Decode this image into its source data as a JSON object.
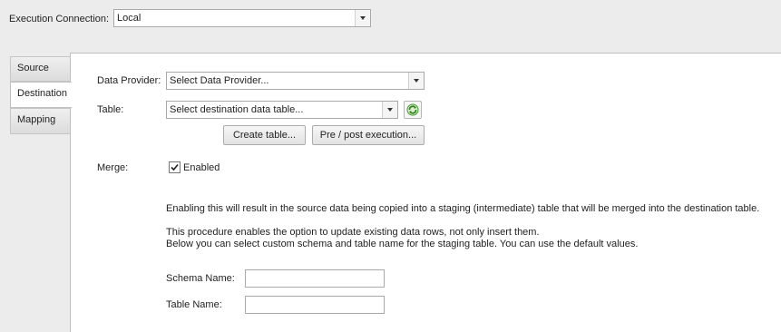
{
  "connection": {
    "label": "Execution Connection:",
    "value": "Local"
  },
  "tabs": [
    {
      "label": "Source",
      "active": false
    },
    {
      "label": "Destination",
      "active": true
    },
    {
      "label": "Mapping",
      "active": false
    }
  ],
  "destination": {
    "data_provider_label": "Data Provider:",
    "data_provider_value": "Select Data Provider...",
    "table_label": "Table:",
    "table_value": "Select destination data table...",
    "create_table_button": "Create table...",
    "pre_post_button": "Pre / post execution...",
    "merge_label": "Merge:",
    "merge_checkbox_label": "Enabled",
    "merge_enabled": true,
    "info_line1": "Enabling this will result in the source data being copied into a staging (intermediate) table that will be merged into the destination table.",
    "info_line2": "This procedure enables the option to update existing data rows, not only insert them.",
    "info_line3": "Below you can select custom schema and table name for the staging table. You can use the default values.",
    "schema_name_label": "Schema Name:",
    "schema_name_value": "",
    "table_name_label": "Table Name:",
    "table_name_value": ""
  },
  "icons": {
    "refresh": "refresh-icon",
    "check": "check-icon",
    "dropdown": "chevron-down-icon"
  },
  "colors": {
    "background": "#ececec",
    "panel": "#ffffff",
    "refresh_green": "#3c9a2a"
  }
}
